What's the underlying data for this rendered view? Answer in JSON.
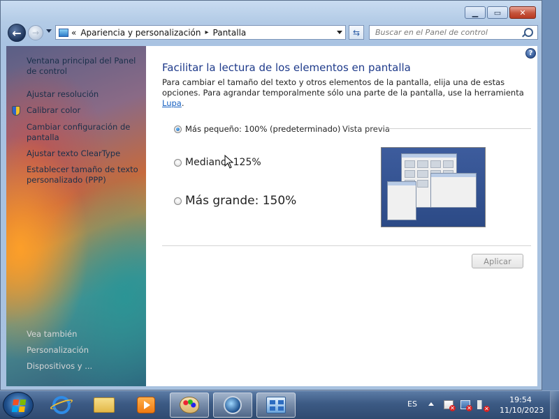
{
  "window": {
    "minimize_icon": "minimize-icon",
    "maximize_icon": "maximize-icon",
    "close_icon": "close-icon"
  },
  "nav": {
    "breadcrumb_overflow": "«",
    "breadcrumb": [
      "Apariencia y personalización",
      "Pantalla"
    ],
    "breadcrumb_separator": "▸",
    "search_placeholder": "Buscar en el Panel de control"
  },
  "sidebar": {
    "home_link": "Ventana principal del Panel de control",
    "tasks": [
      "Ajustar resolución",
      "Calibrar color",
      "Cambiar configuración de pantalla",
      "Ajustar texto ClearType",
      "Establecer tamaño de texto personalizado (PPP)"
    ],
    "see_also_title": "Vea también",
    "see_also": [
      "Personalización",
      "Dispositivos y ..."
    ]
  },
  "main": {
    "title": "Facilitar la lectura de los elementos en pantalla",
    "description_before_link": "Para cambiar el tamaño del texto y otros elementos de la pantalla, elija una de estas opciones. Para agrandar temporalmente sólo una parte de la pantalla, use la herramienta ",
    "description_link": "Lupa",
    "description_after_link": ".",
    "options": [
      {
        "label": "Más pequeño: 100% (predeterminado)",
        "checked": true
      },
      {
        "label": "Mediano: 125%",
        "checked": false
      },
      {
        "label": "Más grande: 150%",
        "checked": false
      }
    ],
    "preview_label": "Vista previa",
    "apply_label": "Aplicar"
  },
  "taskbar": {
    "language": "ES",
    "time": "19:54",
    "date": "11/10/2023"
  },
  "colors": {
    "title_blue": "#1e3a8a",
    "link_blue": "#1660c1"
  }
}
